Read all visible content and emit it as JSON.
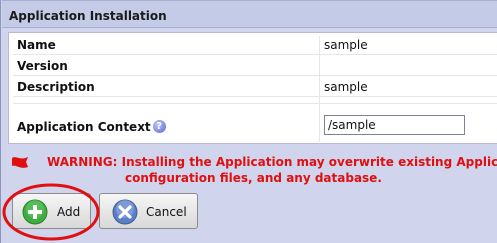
{
  "panel": {
    "title": "Application Installation"
  },
  "properties": {
    "name_label": "Name",
    "name_value": "sample",
    "version_label": "Version",
    "version_value": "",
    "description_label": "Description",
    "description_value": "sample",
    "context_label": "Application Context",
    "context_help_icon": "question-icon",
    "context_value": "/sample"
  },
  "warning": {
    "icon": "red-flag-icon",
    "line1": "WARNING: Installing the Application may overwrite existing Applicat",
    "line2": "configuration files, and any database."
  },
  "buttons": {
    "add_label": "Add",
    "add_icon": "green-plus-icon",
    "cancel_label": "Cancel",
    "cancel_icon": "blue-x-icon"
  },
  "colors": {
    "warning": "#e01010",
    "annotation": "#e01010",
    "panel_background": "#d0d4ec"
  }
}
